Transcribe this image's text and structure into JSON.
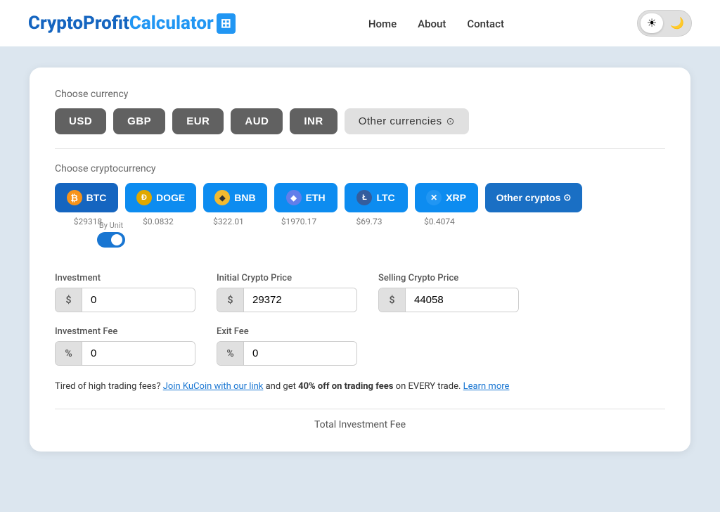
{
  "logo": {
    "text_crypto": "Crypto",
    "text_profit": "Profit",
    "text_calculator": "Calculator",
    "icon": "🖩"
  },
  "nav": {
    "links": [
      "Home",
      "About",
      "Contact"
    ]
  },
  "theme": {
    "light_icon": "☀",
    "dark_icon": "🌙"
  },
  "currency_section": {
    "label": "Choose currency",
    "currencies": [
      "USD",
      "GBP",
      "EUR",
      "AUD",
      "INR"
    ],
    "other_label": "Other currencies",
    "other_icon": "⊙"
  },
  "crypto_section": {
    "label": "Choose cryptocurrency",
    "cryptos": [
      {
        "id": "btc",
        "label": "BTC",
        "price": "$29318",
        "icon": "₿",
        "icon_class": "btc-icon"
      },
      {
        "id": "doge",
        "label": "DOGE",
        "price": "$0.0832",
        "icon": "Ð",
        "icon_class": "doge-icon"
      },
      {
        "id": "bnb",
        "label": "BNB",
        "price": "$322.01",
        "icon": "◆",
        "icon_class": "bnb-icon"
      },
      {
        "id": "eth",
        "label": "ETH",
        "price": "$1970.17",
        "icon": "◆",
        "icon_class": "eth-icon"
      },
      {
        "id": "ltc",
        "label": "LTC",
        "price": "$69.73",
        "icon": "Ł",
        "icon_class": "ltc-icon"
      },
      {
        "id": "xrp",
        "label": "XRP",
        "price": "$0.4074",
        "icon": "✕",
        "icon_class": "xrp-icon"
      }
    ],
    "other_label": "Other cryptos",
    "other_icon": "⊙"
  },
  "investment": {
    "label": "Investment",
    "by_unit_label": "By Unit",
    "prefix": "$",
    "value": "0"
  },
  "initial_price": {
    "label": "Initial Crypto Price",
    "prefix": "$",
    "value": "29372"
  },
  "selling_price": {
    "label": "Selling Crypto Price",
    "prefix": "$",
    "value": "44058"
  },
  "investment_fee": {
    "label": "Investment Fee",
    "prefix": "%",
    "value": "0"
  },
  "exit_fee": {
    "label": "Exit Fee",
    "prefix": "%",
    "value": "0"
  },
  "promo": {
    "text_before": "Tired of high trading fees?",
    "link1_text": "Join KuCoin with our link",
    "text_middle": "and get",
    "bold_text": "40% off on trading fees",
    "text_after": "on EVERY trade.",
    "link2_text": "Learn more"
  },
  "total": {
    "label": "Total Investment Fee"
  }
}
